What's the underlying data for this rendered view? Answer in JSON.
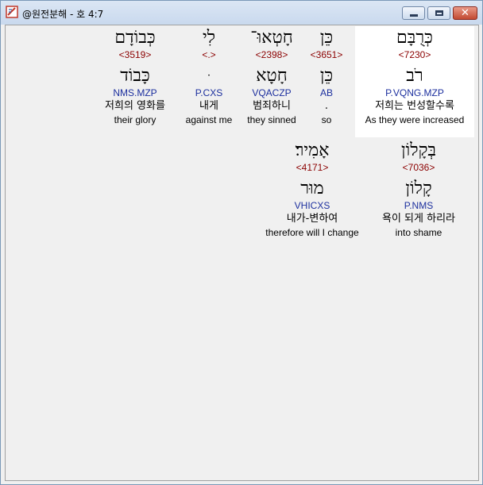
{
  "window": {
    "title": "@원전분해 - 호 4:7",
    "minimize_label": "",
    "maximize_label": "",
    "close_label": "✕"
  },
  "words": [
    {
      "hebrew": "כְּרֻבָּם",
      "strong": "<7230>",
      "lemma": "רֹב",
      "morph": "P.VQNG.MZP",
      "korean": "저희는 번성할수록",
      "english": "As they were increased",
      "highlighted": true
    },
    {
      "hebrew": "כֵּן",
      "strong": "<3651>",
      "lemma": "כֵּן",
      "morph": "AB",
      "korean": ".",
      "english": "so",
      "highlighted": false
    },
    {
      "hebrew": "חָטְאוּ־",
      "strong": "<2398>",
      "lemma": "חָטָא",
      "morph": "VQACZP",
      "korean": "범죄하니",
      "english": "they sinned",
      "highlighted": false
    },
    {
      "hebrew": "לִי",
      "strong": "<.>",
      "lemma": "ּ",
      "morph": "P.CXS",
      "korean": "내게",
      "english": "against me",
      "highlighted": false
    },
    {
      "hebrew": "כְּבוֹדָם",
      "strong": "<3519>",
      "lemma": "כָּבוֹד",
      "morph": "NMS.MZP",
      "korean": "저희의 영화를",
      "english": "their glory",
      "highlighted": false
    },
    {
      "hebrew": "בְּקָלוֹן",
      "strong": "<7036>",
      "lemma": "קָלוֹן",
      "morph": "P.NMS",
      "korean": "욕이 되게 하리라",
      "english": "into shame",
      "highlighted": false
    },
    {
      "hebrew": "אָמִיר׃",
      "strong": "<4171>",
      "lemma": "מוּר",
      "morph": "VHICXS",
      "korean": "내가-변하여",
      "english": "therefore will I change",
      "highlighted": false
    }
  ]
}
